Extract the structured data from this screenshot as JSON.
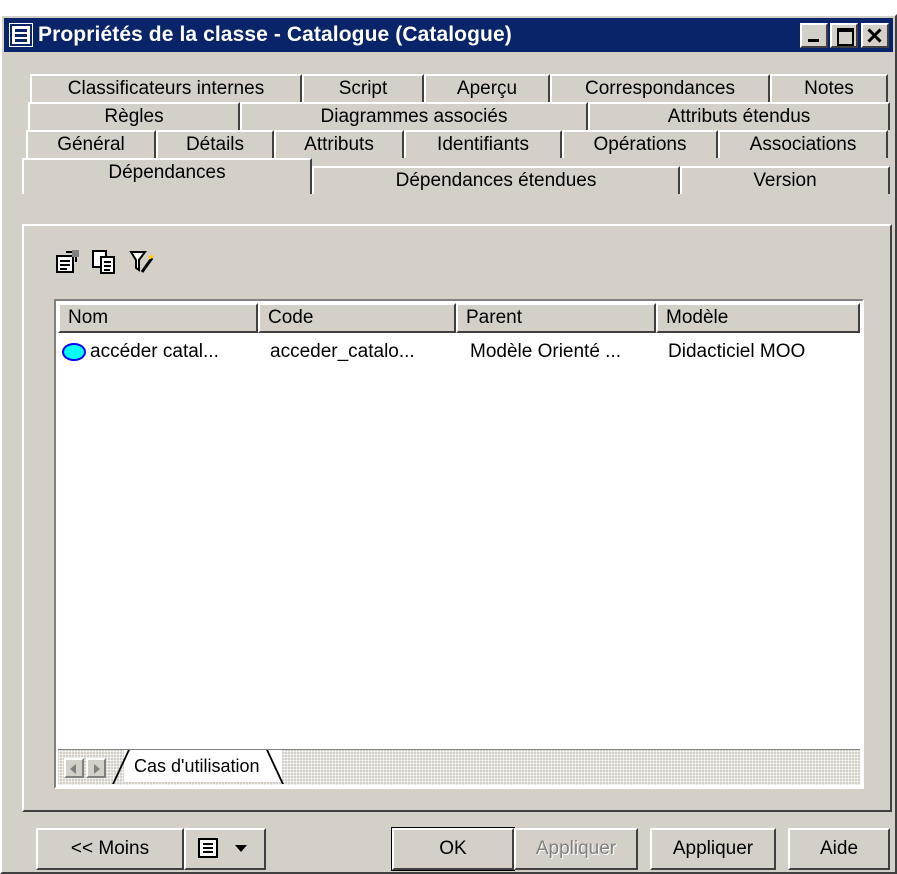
{
  "window": {
    "title": "Propriétés de la classe - Catalogue (Catalogue)"
  },
  "tabs": {
    "row1": [
      {
        "label": "Classificateurs internes"
      },
      {
        "label": "Script"
      },
      {
        "label": "Aperçu"
      },
      {
        "label": "Correspondances"
      },
      {
        "label": "Notes"
      }
    ],
    "row2": [
      {
        "label": "Règles"
      },
      {
        "label": "Diagrammes associés"
      },
      {
        "label": "Attributs étendus"
      }
    ],
    "row3": [
      {
        "label": "Général"
      },
      {
        "label": "Détails"
      },
      {
        "label": "Attributs"
      },
      {
        "label": "Identifiants"
      },
      {
        "label": "Opérations"
      },
      {
        "label": "Associations"
      }
    ],
    "row4": [
      {
        "label": "Dépendances"
      },
      {
        "label": "Dépendances étendues"
      },
      {
        "label": "Version"
      }
    ],
    "active": "Dépendances"
  },
  "toolbar": {
    "icons": [
      "properties-icon",
      "copy-icon",
      "filter-icon"
    ]
  },
  "list": {
    "columns": [
      "Nom",
      "Code",
      "Parent",
      "Modèle"
    ],
    "rows": [
      {
        "icon": "use-case-icon",
        "nom": "accéder catal...",
        "code": "acceder_catalo...",
        "parent": "Modèle Orienté ...",
        "modele": "Didacticiel MOO"
      }
    ],
    "subtab": "Cas d'utilisation"
  },
  "buttons": {
    "moins": "<< Moins",
    "ok": "OK",
    "appliquer_disabled": "Appliquer",
    "appliquer": "Appliquer",
    "aide": "Aide"
  },
  "colors": {
    "titlebar": "#0a246a",
    "face": "#d4d0c8",
    "use_case_fill": "#00ffff",
    "use_case_stroke": "#0000ff"
  }
}
